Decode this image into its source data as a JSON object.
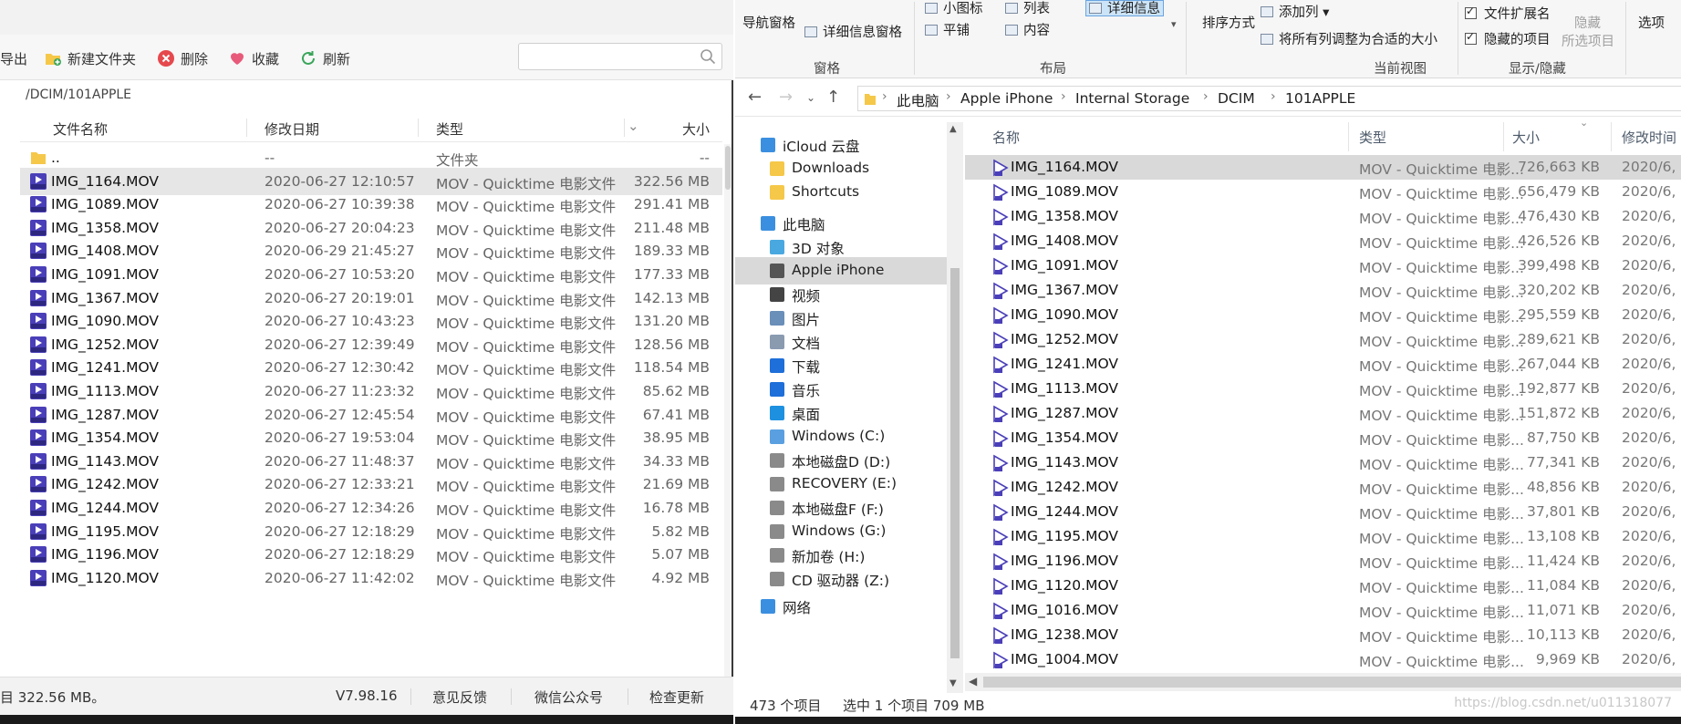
{
  "left_app": {
    "toolbar": {
      "export_label": "导出",
      "new_folder_label": "新建文件夹",
      "delete_label": "删除",
      "favorite_label": "收藏",
      "refresh_label": "刷新"
    },
    "search": {
      "placeholder": ""
    },
    "path": "/DCIM/101APPLE",
    "columns": {
      "name": "文件名称",
      "date": "修改日期",
      "type": "类型",
      "size": "大小"
    },
    "files": [
      {
        "name": "..",
        "date": "--",
        "type": "文件夹",
        "size": "--",
        "kind": "folder"
      },
      {
        "name": "IMG_1164.MOV",
        "date": "2020-06-27 12:10:57",
        "type": "MOV - Quicktime 电影文件",
        "size": "322.56 MB",
        "kind": "mov",
        "selected": true
      },
      {
        "name": "IMG_1089.MOV",
        "date": "2020-06-27 10:39:38",
        "type": "MOV - Quicktime 电影文件",
        "size": "291.41 MB",
        "kind": "mov"
      },
      {
        "name": "IMG_1358.MOV",
        "date": "2020-06-27 20:04:23",
        "type": "MOV - Quicktime 电影文件",
        "size": "211.48 MB",
        "kind": "mov"
      },
      {
        "name": "IMG_1408.MOV",
        "date": "2020-06-29 21:45:27",
        "type": "MOV - Quicktime 电影文件",
        "size": "189.33 MB",
        "kind": "mov"
      },
      {
        "name": "IMG_1091.MOV",
        "date": "2020-06-27 10:53:20",
        "type": "MOV - Quicktime 电影文件",
        "size": "177.33 MB",
        "kind": "mov"
      },
      {
        "name": "IMG_1367.MOV",
        "date": "2020-06-27 20:19:01",
        "type": "MOV - Quicktime 电影文件",
        "size": "142.13 MB",
        "kind": "mov"
      },
      {
        "name": "IMG_1090.MOV",
        "date": "2020-06-27 10:43:23",
        "type": "MOV - Quicktime 电影文件",
        "size": "131.20 MB",
        "kind": "mov"
      },
      {
        "name": "IMG_1252.MOV",
        "date": "2020-06-27 12:39:49",
        "type": "MOV - Quicktime 电影文件",
        "size": "128.56 MB",
        "kind": "mov"
      },
      {
        "name": "IMG_1241.MOV",
        "date": "2020-06-27 12:30:42",
        "type": "MOV - Quicktime 电影文件",
        "size": "118.54 MB",
        "kind": "mov"
      },
      {
        "name": "IMG_1113.MOV",
        "date": "2020-06-27 11:23:32",
        "type": "MOV - Quicktime 电影文件",
        "size": "85.62 MB",
        "kind": "mov"
      },
      {
        "name": "IMG_1287.MOV",
        "date": "2020-06-27 12:45:54",
        "type": "MOV - Quicktime 电影文件",
        "size": "67.41 MB",
        "kind": "mov"
      },
      {
        "name": "IMG_1354.MOV",
        "date": "2020-06-27 19:53:04",
        "type": "MOV - Quicktime 电影文件",
        "size": "38.95 MB",
        "kind": "mov"
      },
      {
        "name": "IMG_1143.MOV",
        "date": "2020-06-27 11:48:37",
        "type": "MOV - Quicktime 电影文件",
        "size": "34.33 MB",
        "kind": "mov"
      },
      {
        "name": "IMG_1242.MOV",
        "date": "2020-06-27 12:33:21",
        "type": "MOV - Quicktime 电影文件",
        "size": "21.69 MB",
        "kind": "mov"
      },
      {
        "name": "IMG_1244.MOV",
        "date": "2020-06-27 12:34:26",
        "type": "MOV - Quicktime 电影文件",
        "size": "16.78 MB",
        "kind": "mov"
      },
      {
        "name": "IMG_1195.MOV",
        "date": "2020-06-27 12:18:29",
        "type": "MOV - Quicktime 电影文件",
        "size": "5.82 MB",
        "kind": "mov"
      },
      {
        "name": "IMG_1196.MOV",
        "date": "2020-06-27 12:18:29",
        "type": "MOV - Quicktime 电影文件",
        "size": "5.07 MB",
        "kind": "mov"
      },
      {
        "name": "IMG_1120.MOV",
        "date": "2020-06-27 11:42:02",
        "type": "MOV - Quicktime 电影文件",
        "size": "4.92 MB",
        "kind": "mov"
      }
    ],
    "status": {
      "summary": "目 322.56 MB。",
      "version": "V7.98.16",
      "feedback": "意见反馈",
      "wechat": "微信公众号",
      "update": "检查更新"
    }
  },
  "explorer": {
    "ribbon": {
      "nav_pane": "导航窗格",
      "details_pane": "详细信息窗格",
      "small_icons": "小图标",
      "list": "列表",
      "details": "详细信息",
      "tiles": "平铺",
      "content": "内容",
      "sort_by": "排序方式",
      "add_columns": "添加列",
      "fit_columns": "将所有列调整为合适的大小",
      "file_ext": "文件扩展名",
      "hidden_items": "隐藏的项目",
      "hide": "隐藏",
      "hide_selected": "所选项目",
      "options": "选项",
      "group_panes": "窗格",
      "group_layout": "布局",
      "group_current_view": "当前视图",
      "group_show_hide": "显示/隐藏"
    },
    "breadcrumb": [
      "此电脑",
      "Apple iPhone",
      "Internal Storage",
      "DCIM",
      "101APPLE"
    ],
    "nav": [
      {
        "label": "iCloud 云盘",
        "icon": "cloud-icon",
        "indent": 1
      },
      {
        "label": "Downloads",
        "icon": "folder-icon",
        "indent": 2
      },
      {
        "label": "Shortcuts",
        "icon": "folder-icon",
        "indent": 2
      },
      {
        "label": "此电脑",
        "icon": "computer-icon",
        "indent": 1
      },
      {
        "label": "3D 对象",
        "icon": "cube-icon",
        "indent": 2
      },
      {
        "label": "Apple iPhone",
        "icon": "phone-icon",
        "indent": 2,
        "selected": true
      },
      {
        "label": "视频",
        "icon": "video-icon",
        "indent": 2
      },
      {
        "label": "图片",
        "icon": "picture-icon",
        "indent": 2
      },
      {
        "label": "文档",
        "icon": "document-icon",
        "indent": 2
      },
      {
        "label": "下载",
        "icon": "download-icon",
        "indent": 2
      },
      {
        "label": "音乐",
        "icon": "music-icon",
        "indent": 2
      },
      {
        "label": "桌面",
        "icon": "desktop-icon",
        "indent": 2
      },
      {
        "label": "Windows (C:)",
        "icon": "system-drive-icon",
        "indent": 2
      },
      {
        "label": "本地磁盘D (D:)",
        "icon": "drive-icon",
        "indent": 2
      },
      {
        "label": "RECOVERY (E:)",
        "icon": "drive-icon",
        "indent": 2
      },
      {
        "label": "本地磁盘F (F:)",
        "icon": "drive-icon",
        "indent": 2
      },
      {
        "label": "Windows (G:)",
        "icon": "drive-icon",
        "indent": 2
      },
      {
        "label": "新加卷 (H:)",
        "icon": "drive-icon",
        "indent": 2
      },
      {
        "label": "CD 驱动器 (Z:)",
        "icon": "cd-drive-icon",
        "indent": 2
      },
      {
        "label": "网络",
        "icon": "network-icon",
        "indent": 1
      }
    ],
    "columns": {
      "name": "名称",
      "type": "类型",
      "size": "大小",
      "date": "修改时间"
    },
    "files": [
      {
        "name": "IMG_1164.MOV",
        "type": "MOV - Quicktime 电影...",
        "size": "726,663 KB",
        "date": "2020/6,",
        "selected": true
      },
      {
        "name": "IMG_1089.MOV",
        "type": "MOV - Quicktime 电影...",
        "size": "656,479 KB",
        "date": "2020/6,"
      },
      {
        "name": "IMG_1358.MOV",
        "type": "MOV - Quicktime 电影...",
        "size": "476,430 KB",
        "date": "2020/6,"
      },
      {
        "name": "IMG_1408.MOV",
        "type": "MOV - Quicktime 电影...",
        "size": "426,526 KB",
        "date": "2020/6,"
      },
      {
        "name": "IMG_1091.MOV",
        "type": "MOV - Quicktime 电影...",
        "size": "399,498 KB",
        "date": "2020/6,"
      },
      {
        "name": "IMG_1367.MOV",
        "type": "MOV - Quicktime 电影...",
        "size": "320,202 KB",
        "date": "2020/6,"
      },
      {
        "name": "IMG_1090.MOV",
        "type": "MOV - Quicktime 电影...",
        "size": "295,559 KB",
        "date": "2020/6,"
      },
      {
        "name": "IMG_1252.MOV",
        "type": "MOV - Quicktime 电影...",
        "size": "289,621 KB",
        "date": "2020/6,"
      },
      {
        "name": "IMG_1241.MOV",
        "type": "MOV - Quicktime 电影...",
        "size": "267,044 KB",
        "date": "2020/6,"
      },
      {
        "name": "IMG_1113.MOV",
        "type": "MOV - Quicktime 电影...",
        "size": "192,877 KB",
        "date": "2020/6,"
      },
      {
        "name": "IMG_1287.MOV",
        "type": "MOV - Quicktime 电影...",
        "size": "151,872 KB",
        "date": "2020/6,"
      },
      {
        "name": "IMG_1354.MOV",
        "type": "MOV - Quicktime 电影...",
        "size": "87,750 KB",
        "date": "2020/6,"
      },
      {
        "name": "IMG_1143.MOV",
        "type": "MOV - Quicktime 电影...",
        "size": "77,341 KB",
        "date": "2020/6,"
      },
      {
        "name": "IMG_1242.MOV",
        "type": "MOV - Quicktime 电影...",
        "size": "48,856 KB",
        "date": "2020/6,"
      },
      {
        "name": "IMG_1244.MOV",
        "type": "MOV - Quicktime 电影...",
        "size": "37,801 KB",
        "date": "2020/6,"
      },
      {
        "name": "IMG_1195.MOV",
        "type": "MOV - Quicktime 电影...",
        "size": "13,108 KB",
        "date": "2020/6,"
      },
      {
        "name": "IMG_1196.MOV",
        "type": "MOV - Quicktime 电影...",
        "size": "11,424 KB",
        "date": "2020/6,"
      },
      {
        "name": "IMG_1120.MOV",
        "type": "MOV - Quicktime 电影...",
        "size": "11,084 KB",
        "date": "2020/6,"
      },
      {
        "name": "IMG_1016.MOV",
        "type": "MOV - Quicktime 电影...",
        "size": "11,071 KB",
        "date": "2020/6,"
      },
      {
        "name": "IMG_1238.MOV",
        "type": "MOV - Quicktime 电影...",
        "size": "10,113 KB",
        "date": "2020/6,"
      },
      {
        "name": "IMG_1004.MOV",
        "type": "MOV - Quicktime 电影...",
        "size": "9,969 KB",
        "date": "2020/6,"
      }
    ],
    "status": {
      "count": "473 个项目",
      "selected": "选中 1 个项目  709 MB"
    },
    "watermark": "https://blog.csdn.net/u011318077"
  },
  "colors": {
    "selection": "#d9d9d9",
    "accent_blue": "#1e6fd9",
    "mov_icon": "#4a3fb8"
  }
}
